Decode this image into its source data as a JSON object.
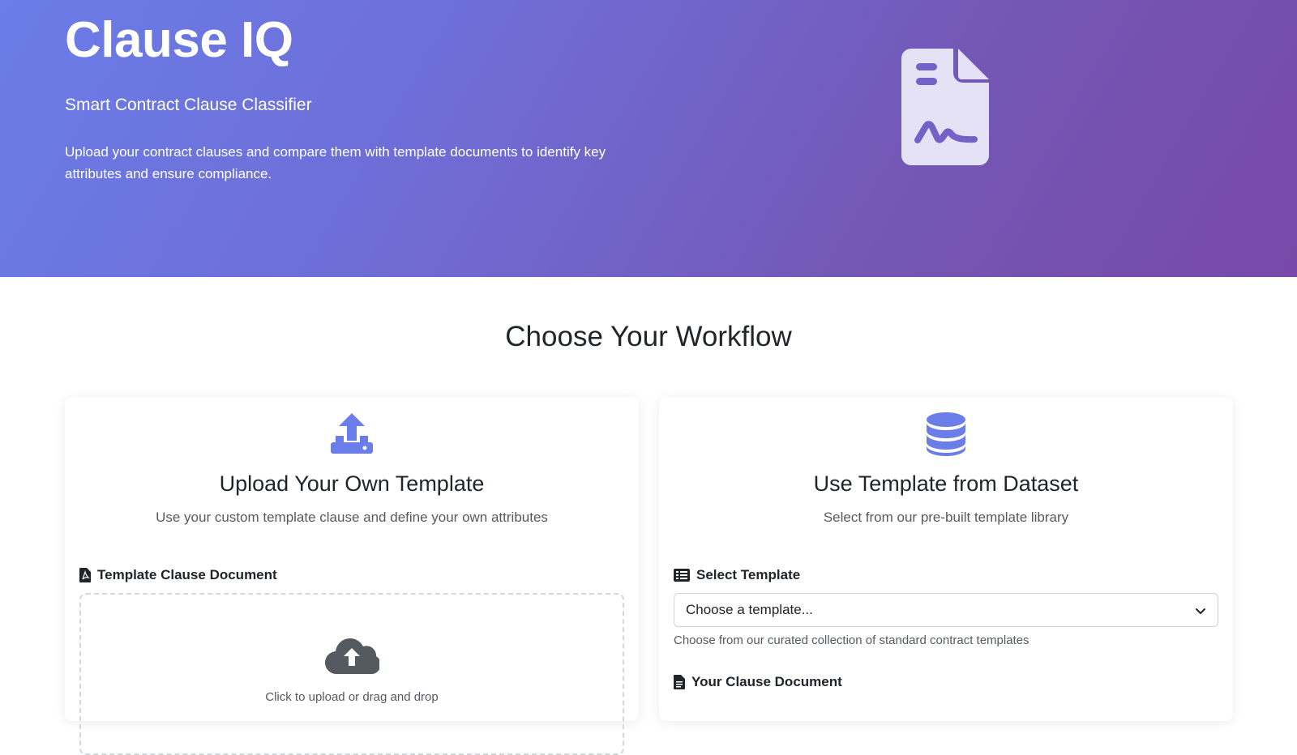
{
  "hero": {
    "title": "Clause IQ",
    "subtitle": "Smart Contract Clause Classifier",
    "description": "Upload your contract clauses and compare them with template documents to identify key attributes and ensure compliance.",
    "icon": "file-signature-icon"
  },
  "workflow": {
    "heading": "Choose Your Workflow"
  },
  "upload_card": {
    "icon": "upload-icon",
    "title": "Upload Your Own Template",
    "description": "Use your custom template clause and define your own attributes",
    "field_label": "Template Clause Document",
    "field_icon": "file-pdf-icon",
    "dropzone_icon": "cloud-upload-icon",
    "dropzone_text": "Click to upload or drag and drop"
  },
  "dataset_card": {
    "icon": "database-icon",
    "title": "Use Template from Dataset",
    "description": "Select from our pre-built template library",
    "select_label": "Select Template",
    "select_icon": "list-icon",
    "select_value": "Choose a template...",
    "select_help": "Choose from our curated collection of standard contract templates",
    "clause_label": "Your Clause Document",
    "clause_icon": "file-icon"
  },
  "colors": {
    "accent": "#6a7de8",
    "hero_gradient_start": "#6a7de8",
    "hero_gradient_end": "#7849a8",
    "icon_fill": "#e4e2f4"
  }
}
